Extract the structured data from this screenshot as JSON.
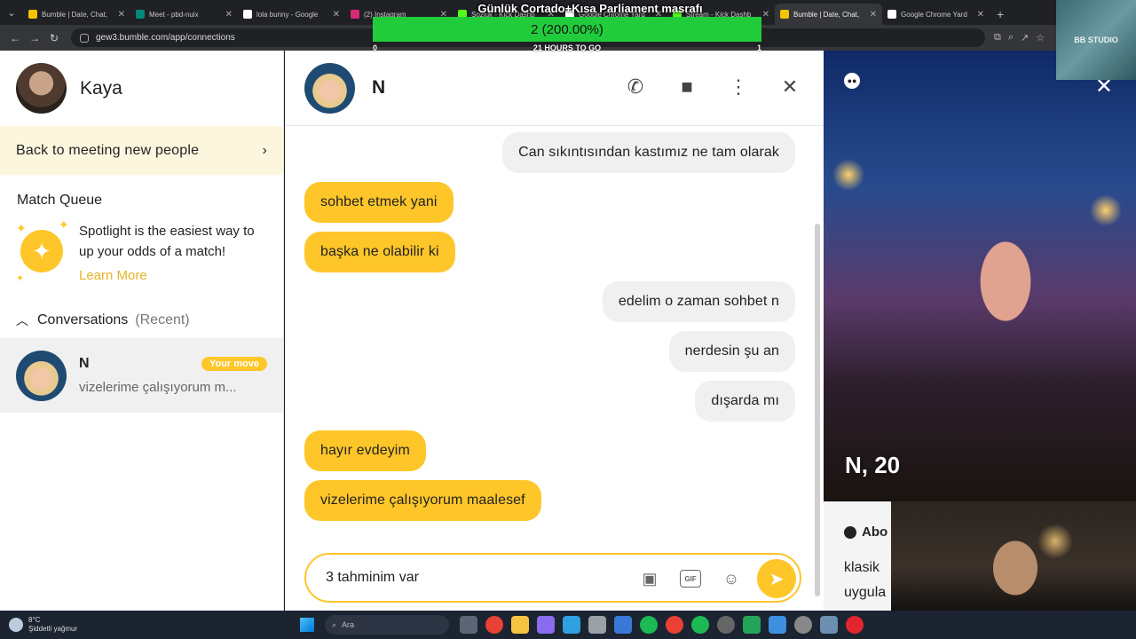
{
  "browser": {
    "tabs": [
      {
        "title": "Bumble | Date, Chat,",
        "color": "#f5c400",
        "active": false
      },
      {
        "title": "Meet - pbd-nuix",
        "color": "#00897b",
        "active": false
      },
      {
        "title": "lola bunny - Google",
        "color": "#ffffff",
        "active": false
      },
      {
        "title": "(2) Instagram",
        "color": "#d62976",
        "active": false
      },
      {
        "title": "Sozluk - Kick Dashb",
        "color": "#53fc18",
        "active": false
      },
      {
        "title": "Google Chrome Yard",
        "color": "#ffffff",
        "active": false
      },
      {
        "title": "Stream - Kick Dashb",
        "color": "#53fc18",
        "active": false
      },
      {
        "title": "Bumble | Date, Chat,",
        "color": "#f5c400",
        "active": true
      },
      {
        "title": "Google Chrome Yard",
        "color": "#ffffff",
        "active": false
      }
    ],
    "url": "gew3.bumble.com/app/connections"
  },
  "overlay": {
    "title": "Günlük Cortado+Kısa Parliament masrafı",
    "progress_text": "2 (200.00%)",
    "left_value": "0",
    "center_text": "21 HOURS TO GO",
    "right_value": "1",
    "studio_label": "BB STUDIO"
  },
  "sidebar": {
    "user_name": "Kaya",
    "back_label": "Back to meeting new people",
    "match_queue_title": "Match Queue",
    "spotlight_text": "Spotlight is the easiest way to up your odds of a match!",
    "learn_more": "Learn More",
    "conversations_label": "Conversations",
    "conversations_sub": "(Recent)",
    "conversation": {
      "name": "N",
      "badge": "Your move",
      "preview": "vizelerime çalışıyorum m..."
    }
  },
  "chat": {
    "name": "N",
    "messages": [
      {
        "text": "Can sıkıntısından kastımız ne tam olarak",
        "dir": "out"
      },
      {
        "text": "sohbet etmek yani",
        "dir": "in"
      },
      {
        "text": "başka ne olabilir ki",
        "dir": "in"
      },
      {
        "text": "edelim o zaman sohbet n",
        "dir": "out"
      },
      {
        "text": "nerdesin şu an",
        "dir": "out"
      },
      {
        "text": "dışarda mı",
        "dir": "out"
      },
      {
        "text": "hayır evdeyim",
        "dir": "in"
      },
      {
        "text": "vizelerime çalışıyorum maalesef",
        "dir": "in"
      }
    ],
    "composer_value": "3 tahminim var",
    "gif_label": "GIF"
  },
  "profile": {
    "name_age": "N, 20",
    "about_label": "Abo",
    "about_line1": "klasik",
    "about_line2": "uygula"
  },
  "taskbar": {
    "weather_temp": "8°C",
    "weather_desc": "Şiddetli yağmur",
    "search_placeholder": "Ara"
  }
}
